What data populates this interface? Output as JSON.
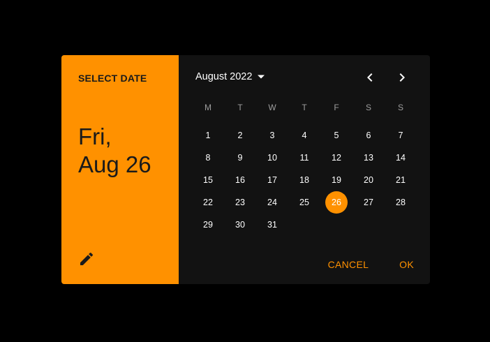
{
  "header": {
    "label": "SELECT DATE",
    "day_line": "Fri,",
    "date_line": "Aug 26",
    "edit_icon": "pencil-icon"
  },
  "calendar": {
    "month_label": "August 2022",
    "prev_icon": "chevron-left-icon",
    "next_icon": "chevron-right-icon",
    "weekdays": [
      "M",
      "T",
      "W",
      "T",
      "F",
      "S",
      "S"
    ],
    "weeks": [
      [
        "1",
        "2",
        "3",
        "4",
        "5",
        "6",
        "7"
      ],
      [
        "8",
        "9",
        "10",
        "11",
        "12",
        "13",
        "14"
      ],
      [
        "15",
        "16",
        "17",
        "18",
        "19",
        "20",
        "21"
      ],
      [
        "22",
        "23",
        "24",
        "25",
        "26",
        "27",
        "28"
      ],
      [
        "29",
        "30",
        "31",
        "",
        "",
        "",
        ""
      ]
    ],
    "selected_day": "26"
  },
  "actions": {
    "cancel_label": "CANCEL",
    "ok_label": "OK"
  },
  "colors": {
    "accent": "#ff9100",
    "surface": "#121212",
    "background": "#000000"
  }
}
